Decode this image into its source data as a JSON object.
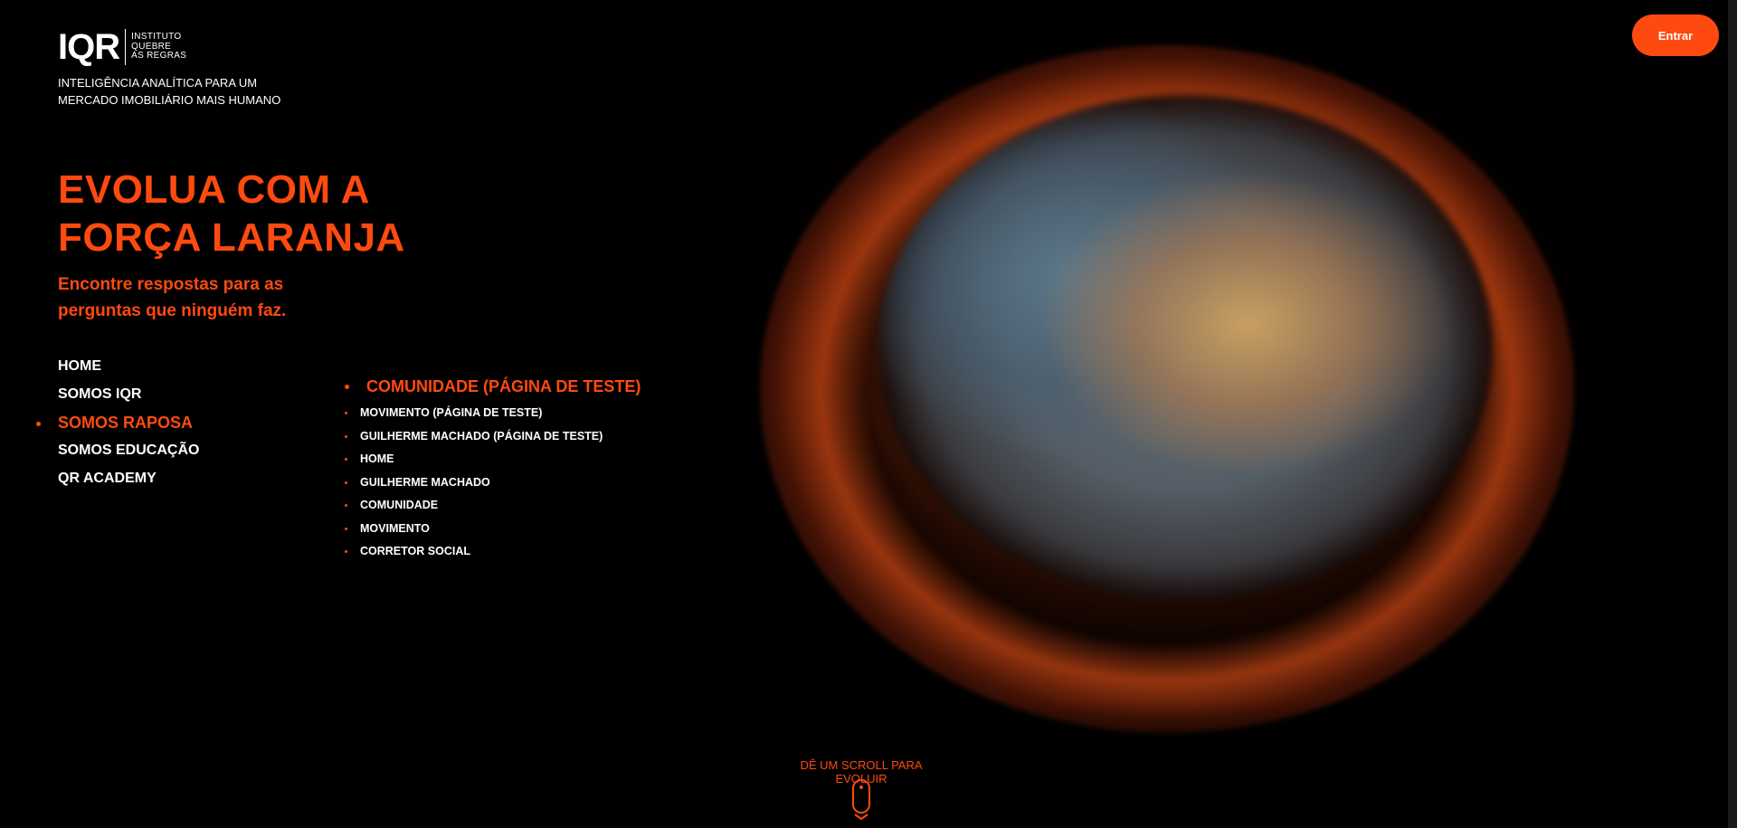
{
  "brand": {
    "logo_text": "IQR",
    "logo_sub": [
      "INSTITUTO",
      "QUEBRE",
      "AS REGRAS"
    ],
    "tagline": "INTELIGÊNCIA ANALÍTICA PARA UM MERCADO IMOBILIÁRIO MAIS HUMANO",
    "accent_color": "#ff4a0f"
  },
  "hero": {
    "title": "EVOLUA COM A FORÇA LARANJA",
    "subtitle": "Encontre respostas para as perguntas que ninguém faz."
  },
  "nav": {
    "items": [
      {
        "label": "HOME",
        "active": false
      },
      {
        "label": "SOMOS IQR",
        "active": false
      },
      {
        "label": "SOMOS RAPOSA",
        "active": true
      },
      {
        "label": "SOMOS EDUCAÇÃO",
        "active": false
      },
      {
        "label": "QR ACADEMY",
        "active": false
      }
    ]
  },
  "subnav": {
    "items": [
      {
        "label": "COMUNIDADE (PÁGINA DE TESTE)",
        "active": true
      },
      {
        "label": "MOVIMENTO (PÁGINA DE TESTE)",
        "active": false
      },
      {
        "label": "GUILHERME MACHADO (PÁGINA DE TESTE)",
        "active": false
      },
      {
        "label": "HOME",
        "active": false
      },
      {
        "label": "GUILHERME MACHADO",
        "active": false
      },
      {
        "label": "COMUNIDADE",
        "active": false
      },
      {
        "label": "MOVIMENTO",
        "active": false
      },
      {
        "label": "CORRETOR SOCIAL",
        "active": false
      }
    ]
  },
  "header": {
    "enter_label": "Entrar"
  },
  "scroll": {
    "hint": "DÊ UM SCROLL PARA EVOLUIR",
    "icon": "mouse-scroll-icon"
  }
}
